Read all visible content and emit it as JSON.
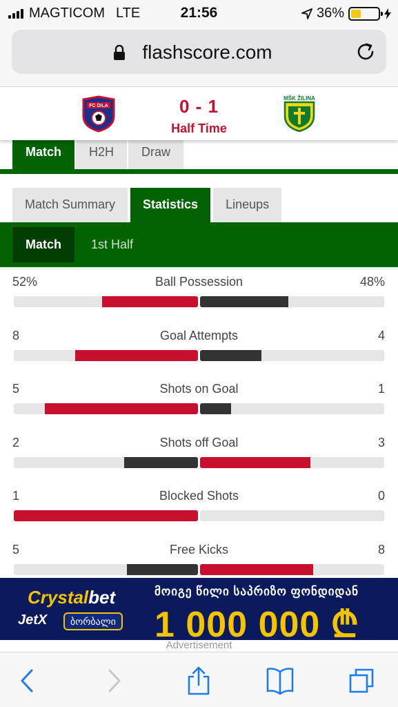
{
  "status_bar": {
    "carrier": "MAGTICOM",
    "network": "LTE",
    "time": "21:56",
    "battery": "36%",
    "battery_level": 0.36
  },
  "browser": {
    "url": "flashscore.com"
  },
  "match": {
    "score": "0 - 1",
    "status": "Half Time",
    "home_logo_icon": "fc-dila-crest-icon",
    "away_logo_icon": "msk-zilina-crest-icon"
  },
  "top_tabs": [
    {
      "label": "Match",
      "active": true
    },
    {
      "label": "H2H",
      "active": false
    },
    {
      "label": "Draw",
      "active": false
    }
  ],
  "sub_tabs": [
    {
      "label": "Match Summary",
      "active": false
    },
    {
      "label": "Statistics",
      "active": true
    },
    {
      "label": "Lineups",
      "active": false
    }
  ],
  "periods": [
    {
      "label": "Match",
      "active": true
    },
    {
      "label": "1st Half",
      "active": false
    }
  ],
  "stats": [
    {
      "name": "Ball Possession",
      "home": "52%",
      "away": "48%",
      "home_val": 52,
      "away_val": 48,
      "leader": "home"
    },
    {
      "name": "Goal Attempts",
      "home": "8",
      "away": "4",
      "home_val": 8,
      "away_val": 4,
      "leader": "home"
    },
    {
      "name": "Shots on Goal",
      "home": "5",
      "away": "1",
      "home_val": 5,
      "away_val": 1,
      "leader": "home"
    },
    {
      "name": "Shots off Goal",
      "home": "2",
      "away": "3",
      "home_val": 2,
      "away_val": 3,
      "leader": "away"
    },
    {
      "name": "Blocked Shots",
      "home": "1",
      "away": "0",
      "home_val": 1,
      "away_val": 0,
      "leader": "home"
    },
    {
      "name": "Free Kicks",
      "home": "5",
      "away": "8",
      "home_val": 5,
      "away_val": 8,
      "leader": "away"
    }
  ],
  "ad": {
    "brand_a": "Crystal",
    "brand_b": "bet",
    "jetx": "JetX",
    "jetx_pill": "ბორბალი",
    "headline": "მოიგე წილი საპრიზო ფონდიდან",
    "amount": "1 000 000 ₾",
    "caption": "Advertisement"
  },
  "colors": {
    "brand_green": "#016302",
    "highlight_red": "#c8102e",
    "bar_dark": "#333333",
    "track": "#e6e6e6"
  },
  "toolbar_icons": [
    "back-icon",
    "forward-icon",
    "share-icon",
    "bookmarks-icon",
    "tabs-icon"
  ]
}
